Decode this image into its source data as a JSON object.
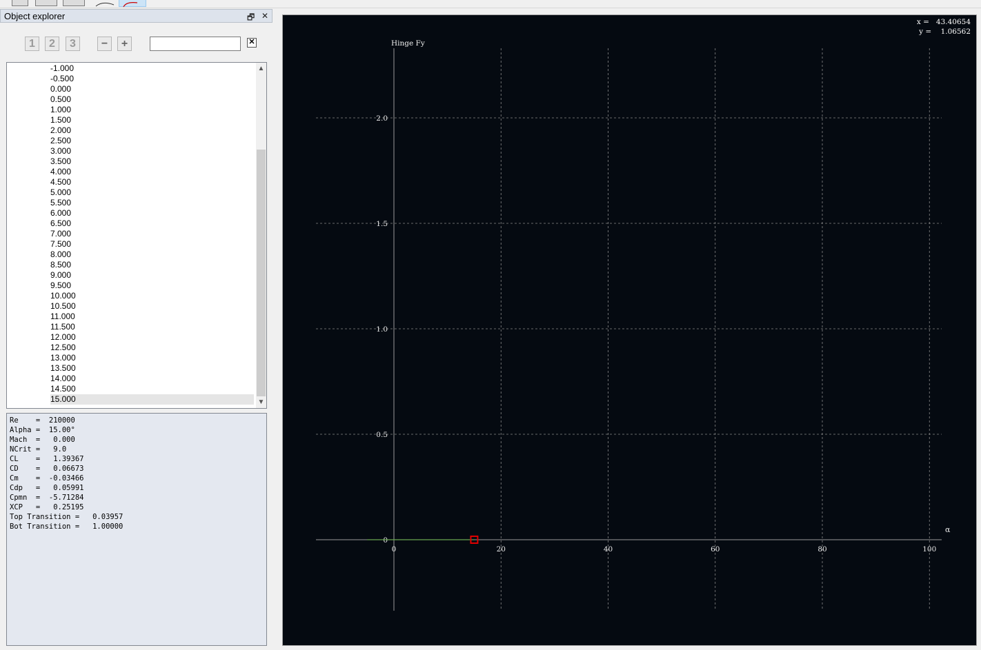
{
  "toolbar": {
    "icons": [
      "toolbar-button-1",
      "toolbar-button-2",
      "toolbar-button-3",
      "airfoil-view-icon",
      "polar-view-icon"
    ]
  },
  "explorer": {
    "title": "Object explorer",
    "restore_icon": "🗗",
    "close_icon": "✕",
    "level_buttons": [
      "1",
      "2",
      "3"
    ],
    "collapse_label": "−",
    "expand_label": "+",
    "search_value": "",
    "clear_label": "✕",
    "items": [
      "-1.000",
      "-0.500",
      "0.000",
      "0.500",
      "1.000",
      "1.500",
      "2.000",
      "2.500",
      "3.000",
      "3.500",
      "4.000",
      "4.500",
      "5.000",
      "5.500",
      "6.000",
      "6.500",
      "7.000",
      "7.500",
      "8.000",
      "8.500",
      "9.000",
      "9.500",
      "10.000",
      "10.500",
      "11.000",
      "11.500",
      "12.000",
      "12.500",
      "13.000",
      "13.500",
      "14.000",
      "14.500",
      "15.000"
    ],
    "selected_item": "15.000"
  },
  "properties": {
    "lines": [
      "Re    =  210000",
      "Alpha =  15.00°",
      "Mach  =   0.000",
      "NCrit =   9.0",
      "CL    =   1.39367",
      "CD    =   0.06673",
      "Cm    =  -0.03466",
      "Cdp   =   0.05991",
      "Cpmn  =  -5.71284",
      "XCP   =   0.25195",
      "Top Transition =   0.03957",
      "Bot Transition =   1.00000"
    ]
  },
  "plot": {
    "readout_x": "x =   43.40654",
    "readout_y": "y =    1.06562",
    "background": "#050a11",
    "grid_color": "#8a8a8a",
    "curve_color": "#6aa84f",
    "marker_color": "#e00000"
  },
  "chart_data": {
    "type": "line",
    "title": "Hinge Fy",
    "xlabel": "α",
    "ylabel": "",
    "xlim": [
      -15,
      102
    ],
    "ylim": [
      -0.33,
      2.33
    ],
    "xticks": [
      0,
      20,
      40,
      60,
      80,
      100
    ],
    "xtick_labels": [
      "0",
      "20",
      "40",
      "60",
      "80",
      "100"
    ],
    "yticks": [
      0,
      0.5,
      1.0,
      1.5,
      2.0
    ],
    "ytick_labels": [
      "0",
      "0.5",
      "1.0",
      "1.5",
      "2.0"
    ],
    "grid": true,
    "series": [
      {
        "x": [
          -5,
          0,
          5,
          10,
          15
        ],
        "y": [
          0,
          0,
          0,
          0,
          0
        ]
      }
    ],
    "highlight_point": {
      "x": 15,
      "y": 0
    }
  }
}
